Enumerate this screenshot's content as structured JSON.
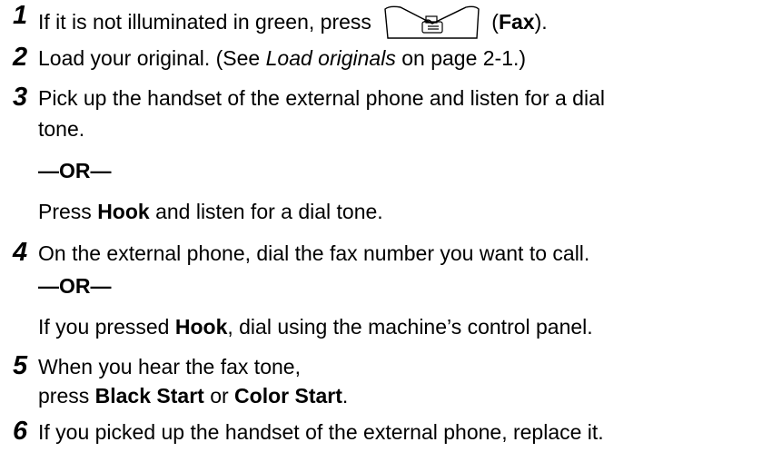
{
  "steps": [
    {
      "number": "1",
      "text_before": "If it is not illuminated in green, press ",
      "button_icon": "fax-button-icon",
      "paren_open": "(",
      "bold": "Fax",
      "paren_close": ")."
    },
    {
      "number": "2",
      "text_before": "Load your original. (See ",
      "italic": "Load originals",
      "text_after": " on page 2-1.)"
    },
    {
      "number": "3",
      "line1": "Pick up the handset of the external phone and listen for a dial",
      "line2": "tone.",
      "or_label": "—OR—",
      "alt_before": "Press ",
      "alt_bold": "Hook",
      "alt_after": " and listen for a dial tone."
    },
    {
      "number": "4",
      "line1": "On the external phone, dial the fax number you want to call.",
      "or_label": "—OR—",
      "alt_before": "If you pressed ",
      "alt_bold": "Hook",
      "alt_after": ", dial using the machine’s control panel."
    },
    {
      "number": "5",
      "line1": "When you hear the fax tone,",
      "line2_before": "press ",
      "line2_bold1": "Black Start",
      "line2_mid": " or ",
      "line2_bold2": "Color Start",
      "line2_after": "."
    },
    {
      "number": "6",
      "line1": "If you picked up the handset of the external phone, replace it."
    }
  ]
}
